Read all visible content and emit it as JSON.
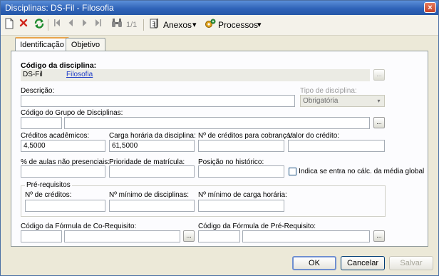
{
  "window": {
    "title": "Disciplinas: DS-Fil - Filosofia",
    "close_glyph": "×"
  },
  "toolbar": {
    "pager": "1/1",
    "anexos": "Anexos",
    "processos": "Processos",
    "menu_arrow": "▾",
    "icons": [
      "new-icon",
      "delete-icon",
      "refresh-icon",
      "first-icon",
      "prev-icon",
      "next-icon",
      "last-icon",
      "binoculars-icon",
      "attachment-icon",
      "process-icon"
    ]
  },
  "tabs": [
    {
      "label": "Identificação"
    },
    {
      "label": "Objetivo"
    }
  ],
  "form": {
    "codigo_label": "Código da disciplina:",
    "codigo_value": "DS-Fil",
    "codigo_link": "Filosofia",
    "descricao_label": "Descrição:",
    "tipo_label": "Tipo de disciplina:",
    "tipo_value": "Obrigatória",
    "grupo_label": "Código do Grupo de Disciplinas:",
    "creditos_label": "Créditos acadêmicos:",
    "creditos_value": "4,5000",
    "carga_label": "Carga horária da disciplina:",
    "carga_value": "61,5000",
    "cobranca_label": "Nº de créditos para cobrança:",
    "valor_label": "Valor do crédito:",
    "aulas_label": "% de aulas não presenciais:",
    "prioridade_label": "Prioridade de matrícula:",
    "posicao_label": "Posição no histórico:",
    "media_label": "Indica se entra no cálc. da média global",
    "prereq_title": "Pré-requisitos",
    "nc_label": "Nº de créditos:",
    "nmd_label": "Nº mínimo de disciplinas:",
    "nmc_label": "Nº mínimo de carga horária:",
    "corequisito_label": "Código da Fórmula de Co-Requisito:",
    "prerequisito_label": "Código da Fórmula de Pré-Requisito:",
    "lookup": "..."
  },
  "footer": {
    "ok": "OK",
    "cancelar": "Cancelar",
    "salvar": "Salvar"
  },
  "colors": {
    "titlebar": "#2f63b8",
    "link": "#1f3dc8",
    "active_tab_accent": "#e8a44b"
  }
}
